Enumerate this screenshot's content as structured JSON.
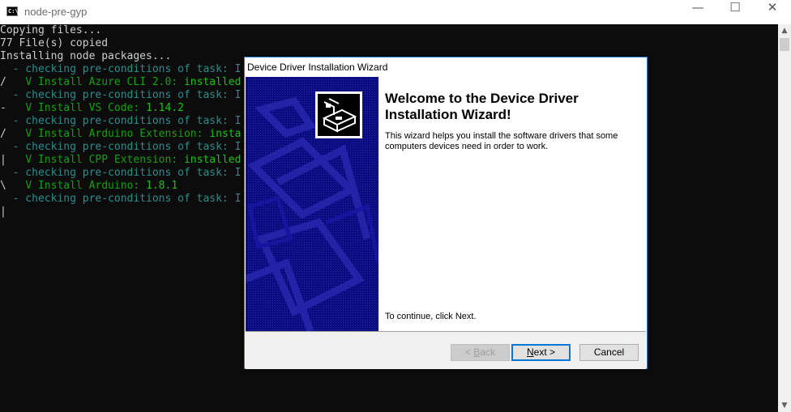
{
  "console_window": {
    "title": "node-pre-gyp",
    "icon": "cmd-icon",
    "icon_text": "C:\\",
    "controls": {
      "minimize": "—",
      "maximize": "☐",
      "close": "✕"
    }
  },
  "console": {
    "lines": [
      {
        "prefix": "",
        "text": "Copying files...",
        "style": "plain"
      },
      {
        "prefix": "",
        "text": "77 File(s) copied",
        "style": "plain"
      },
      {
        "prefix": "",
        "text": "Installing node packages...",
        "style": "plain"
      },
      {
        "prefix": "  ",
        "text": "- checking pre-conditions of task: I",
        "style": "check"
      },
      {
        "prefix": "/   ",
        "text": "V Install Azure CLI 2.0:",
        "value": " installed",
        "style": "done"
      },
      {
        "prefix": "  ",
        "text": "- checking pre-conditions of task: I",
        "style": "check"
      },
      {
        "prefix": "-   ",
        "text": "V Install VS Code:",
        "value": " 1.14.2",
        "style": "done"
      },
      {
        "prefix": "  ",
        "text": "- checking pre-conditions of task: I",
        "style": "check"
      },
      {
        "prefix": "/   ",
        "text": "V Install Arduino Extension:",
        "value": " insta",
        "style": "done"
      },
      {
        "prefix": "  ",
        "text": "- checking pre-conditions of task: I",
        "style": "check"
      },
      {
        "prefix": "|   ",
        "text": "V Install CPP Extension:",
        "value": " installed",
        "style": "done"
      },
      {
        "prefix": "  ",
        "text": "- checking pre-conditions of task: I",
        "style": "check"
      },
      {
        "prefix": "\\   ",
        "text": "V Install Arduino:",
        "value": " 1.8.1",
        "style": "done"
      },
      {
        "prefix": "  ",
        "text": "- checking pre-conditions of task: I",
        "style": "check"
      }
    ],
    "cursor": "|"
  },
  "scrollbar": {
    "up": "▲",
    "down": "▼"
  },
  "dialog": {
    "title": "Device Driver Installation Wizard",
    "heading": "Welcome to the Device Driver Installation Wizard!",
    "description": "This wizard helps you install the software drivers that some computers devices need in order to work.",
    "continue_text": "To continue, click Next.",
    "side_icon": "hardware-card-icon",
    "buttons": {
      "back": {
        "label_prefix": "< ",
        "label_underline": "B",
        "label_rest": "ack",
        "enabled": false
      },
      "next": {
        "label_underline": "N",
        "label_rest": "ext >",
        "enabled": true,
        "default": true
      },
      "cancel": {
        "label": "Cancel",
        "enabled": true
      }
    }
  },
  "colors": {
    "console_bg": "#0c0c0c",
    "console_text": "#cccccc",
    "check_text": "#3a96dd",
    "done_text": "#13a10e",
    "value_text": "#16c60c",
    "wizard_side": "#0b0b80",
    "dialog_border": "#2b7bd1"
  }
}
